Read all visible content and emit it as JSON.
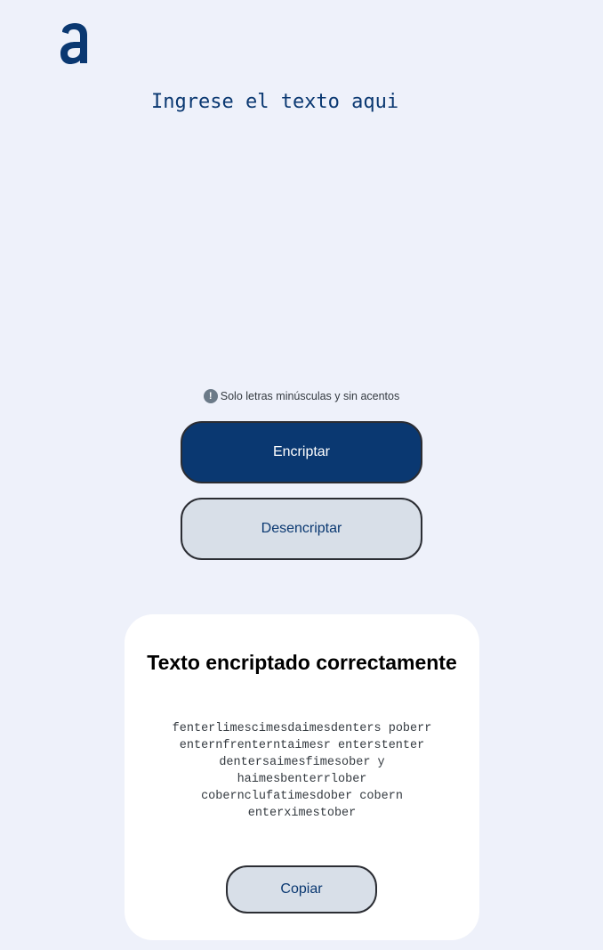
{
  "logo": {
    "icon": "alura-a-logo-icon",
    "color": "#0a3871"
  },
  "input": {
    "placeholder": "Ingrese el texto aqui",
    "value": ""
  },
  "hint": {
    "icon": "info-icon",
    "text": "Solo letras minúsculas y sin acentos"
  },
  "buttons": {
    "encrypt_label": "Encriptar",
    "decrypt_label": "Desencriptar"
  },
  "output": {
    "title": "Texto encriptado correctamente",
    "text": "fenterlimescimesdaimesdenters poberr enternfrenterntaimesr enterstenter dentersaimesfimesober y haimesbenterrlober cobernclufatimesdober cobern enterximestober",
    "copy_label": "Copiar"
  },
  "colors": {
    "background": "#eef1fa",
    "primary": "#0a3871",
    "secondary_button": "#d8dfe8",
    "card": "#ffffff"
  }
}
